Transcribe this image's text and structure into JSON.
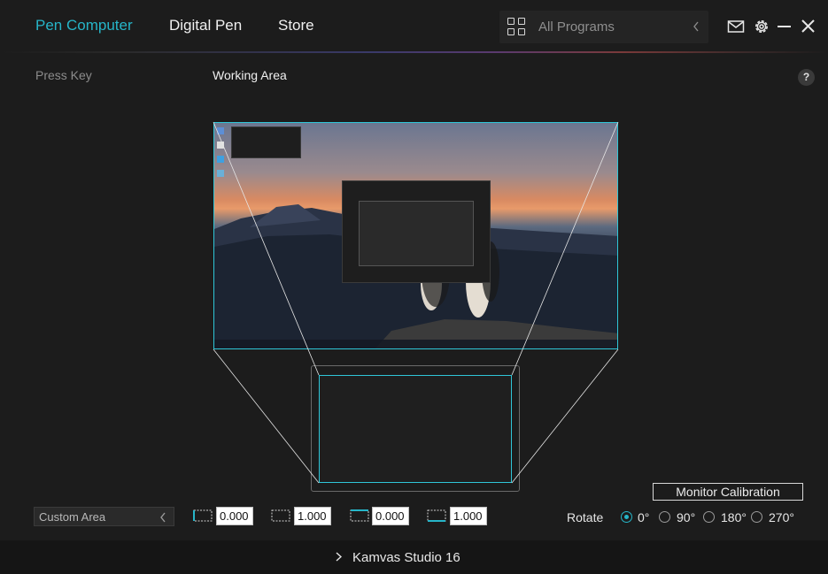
{
  "nav": {
    "tabs": [
      {
        "label": "Pen Computer",
        "active": true
      },
      {
        "label": "Digital Pen",
        "active": false
      },
      {
        "label": "Store",
        "active": false
      }
    ]
  },
  "program_select": {
    "placeholder": "All Programs",
    "icon": "apps-grid-icon"
  },
  "header_icons": [
    "mail-icon",
    "gear-icon",
    "minimize-icon",
    "close-icon"
  ],
  "subheader": {
    "press_key": "Press Key",
    "working_area": "Working Area",
    "help": "?"
  },
  "calibration": {
    "label": "Monitor Calibration"
  },
  "area": {
    "mode": "Custom Area",
    "x_offset": "0.000",
    "x_size": "1.000",
    "y_offset": "0.000",
    "y_size": "1.000"
  },
  "rotate": {
    "label": "Rotate",
    "options": [
      "0°",
      "90°",
      "180°",
      "270°"
    ],
    "selected": "0°"
  },
  "footer": {
    "device": "Kamvas Studio 16"
  },
  "colors": {
    "accent": "#26b5c8",
    "background": "#1c1c1c",
    "footer": "#151515"
  }
}
